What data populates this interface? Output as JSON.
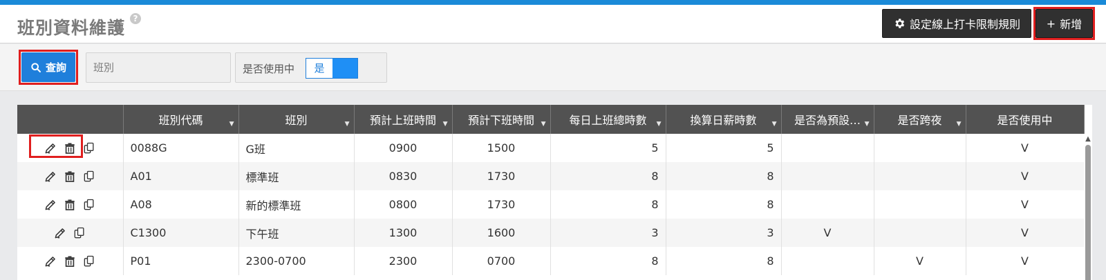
{
  "header": {
    "title": "班別資料維護",
    "help": "?",
    "rule_button_label": "設定線上打卡限制規則",
    "add_button_label": "新增",
    "add_button_prefix": "+"
  },
  "filter": {
    "query_label": "查詢",
    "shift_placeholder": "班別",
    "inuse_label": "是否使用中",
    "inuse_value": "是"
  },
  "table": {
    "columns": [
      {
        "label": "",
        "filter": false
      },
      {
        "label": "班別代碼",
        "filter": true
      },
      {
        "label": "班別",
        "filter": true
      },
      {
        "label": "預計上班時間",
        "filter": true
      },
      {
        "label": "預計下班時間",
        "filter": true
      },
      {
        "label": "每日上班總時數",
        "filter": true
      },
      {
        "label": "換算日薪時數",
        "filter": true
      },
      {
        "label": "是否為預設…",
        "filter": true
      },
      {
        "label": "是否跨夜",
        "filter": true
      },
      {
        "label": "是否使用中",
        "filter": false
      }
    ],
    "rows": [
      {
        "actions": [
          "edit",
          "delete",
          "copy"
        ],
        "code": "0088G",
        "name": "G班",
        "start": "0900",
        "end": "1500",
        "daily_hours": "5",
        "pay_hours": "5",
        "is_default": "",
        "overnight": "",
        "in_use": "V"
      },
      {
        "actions": [
          "edit",
          "delete",
          "copy"
        ],
        "code": "A01",
        "name": "標準班",
        "start": "0830",
        "end": "1730",
        "daily_hours": "8",
        "pay_hours": "8",
        "is_default": "",
        "overnight": "",
        "in_use": "V"
      },
      {
        "actions": [
          "edit",
          "delete",
          "copy"
        ],
        "code": "A08",
        "name": "新的標準班",
        "start": "0800",
        "end": "1730",
        "daily_hours": "8",
        "pay_hours": "8",
        "is_default": "",
        "overnight": "",
        "in_use": "V"
      },
      {
        "actions": [
          "edit",
          "copy"
        ],
        "code": "C1300",
        "name": "下午班",
        "start": "1300",
        "end": "1600",
        "daily_hours": "3",
        "pay_hours": "3",
        "is_default": "V",
        "overnight": "",
        "in_use": "V"
      },
      {
        "actions": [
          "edit",
          "delete",
          "copy"
        ],
        "code": "P01",
        "name": "2300-0700",
        "start": "2300",
        "end": "0700",
        "daily_hours": "8",
        "pay_hours": "8",
        "is_default": "",
        "overnight": "V",
        "in_use": "V"
      }
    ]
  },
  "colors": {
    "accent": "#1a8ad8",
    "query_button": "#1f7fdb",
    "header_bg": "#525252",
    "dark_button": "#303030",
    "highlight_outline": "#e01e1e"
  },
  "icons": {
    "help": "help-icon",
    "gear": "gear-icon",
    "search": "search-icon",
    "edit": "edit-icon",
    "delete": "delete-icon",
    "copy": "copy-icon",
    "filter": "filter-icon"
  }
}
